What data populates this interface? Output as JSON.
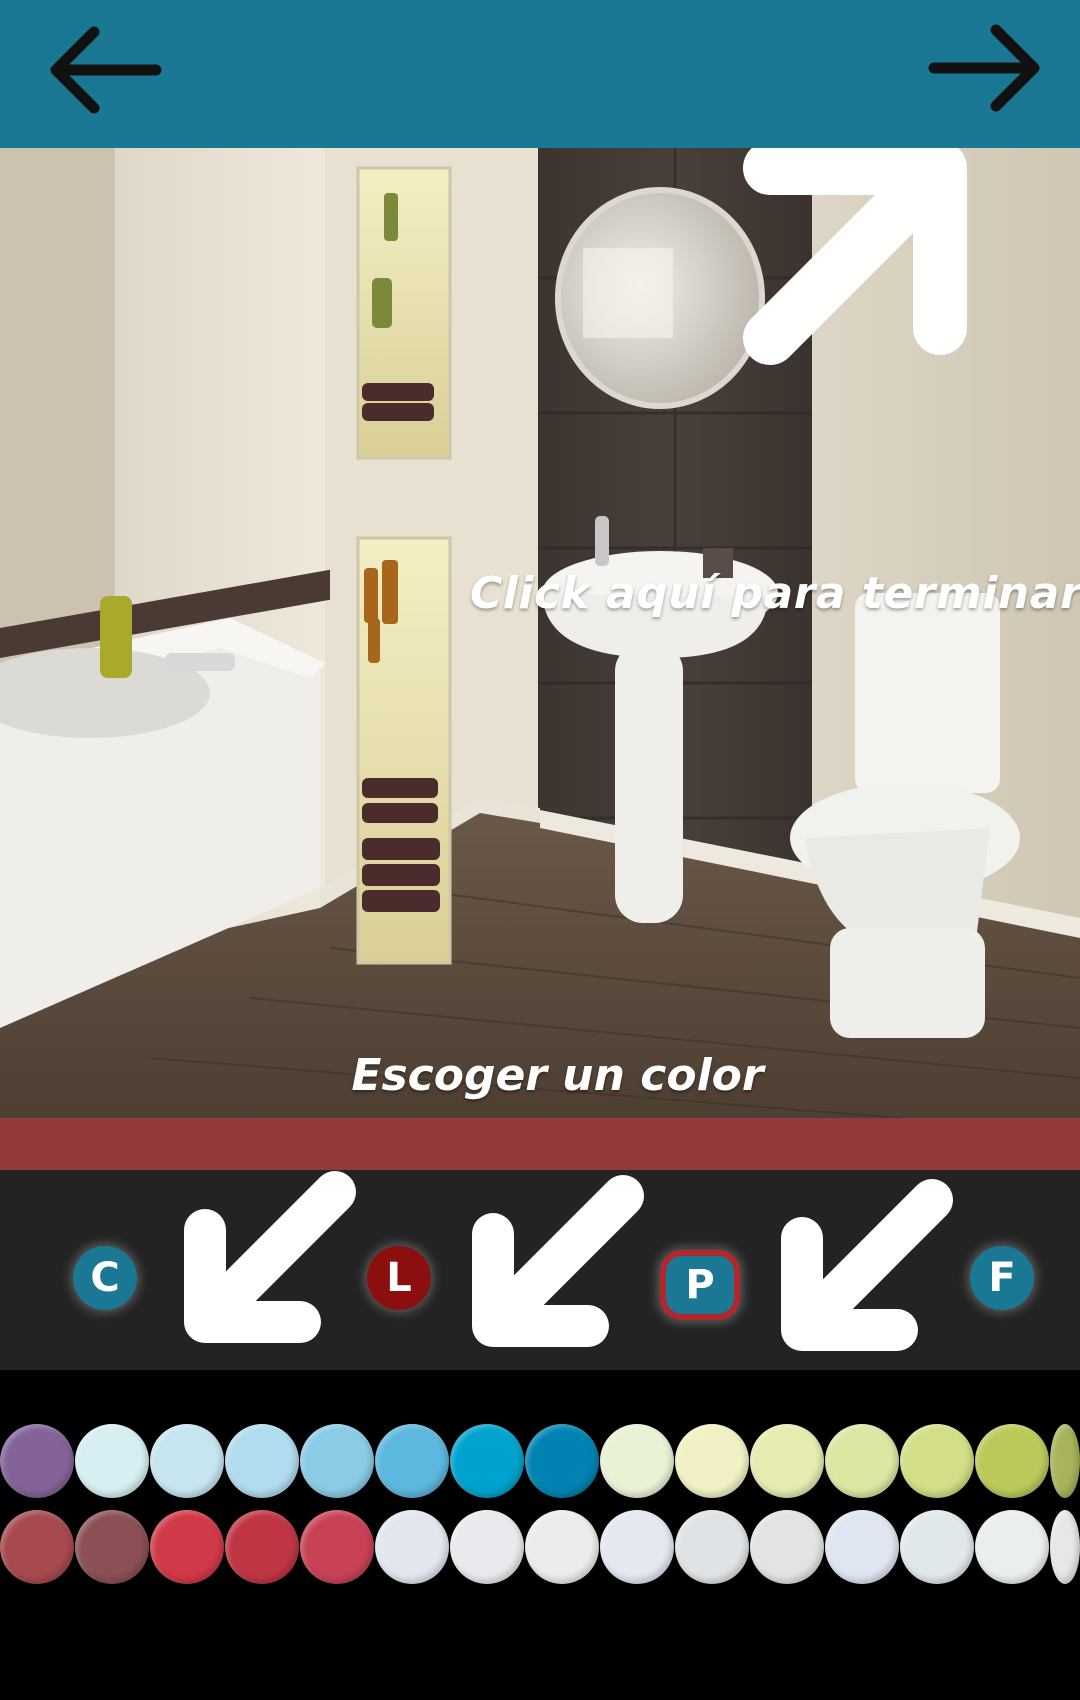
{
  "nav": {
    "back_icon": "arrow-left-icon",
    "forward_icon": "arrow-right-icon",
    "bar_color": "#1a7894"
  },
  "scene": {
    "finish_text": "Click aquí para terminar",
    "pick_color_text": "Escoger un color"
  },
  "accent_bar_color": "#953a3c",
  "tools": [
    {
      "letter": "C",
      "color": "#1a7894",
      "selected": false
    },
    {
      "letter": "L",
      "color": "#8b0f0f",
      "selected": false
    },
    {
      "letter": "P",
      "color": "#1a7894",
      "selected": true
    },
    {
      "letter": "F",
      "color": "#1a7894",
      "selected": false
    }
  ],
  "palette": {
    "row1": [
      "#846399",
      "#d7eef2",
      "#c7e5f0",
      "#b0dcee",
      "#8acbe6",
      "#5db8de",
      "#00a3cd",
      "#0083b2",
      "#e9f2d6",
      "#f1f1c5",
      "#e6ebb1",
      "#dde6a3",
      "#d3de86",
      "#bcc95a",
      "#a8b35a"
    ],
    "row2": [
      "#a64a4f",
      "#8b5055",
      "#d03a48",
      "#c03544",
      "#c84257",
      "#e2e7ef",
      "#e8eaee",
      "#ececeb",
      "#e3e8f1",
      "#e0e3e6",
      "#e2e3e3",
      "#dfe6f1",
      "#e1e8ec",
      "#eaeeee",
      "#e5e8e6"
    ]
  }
}
